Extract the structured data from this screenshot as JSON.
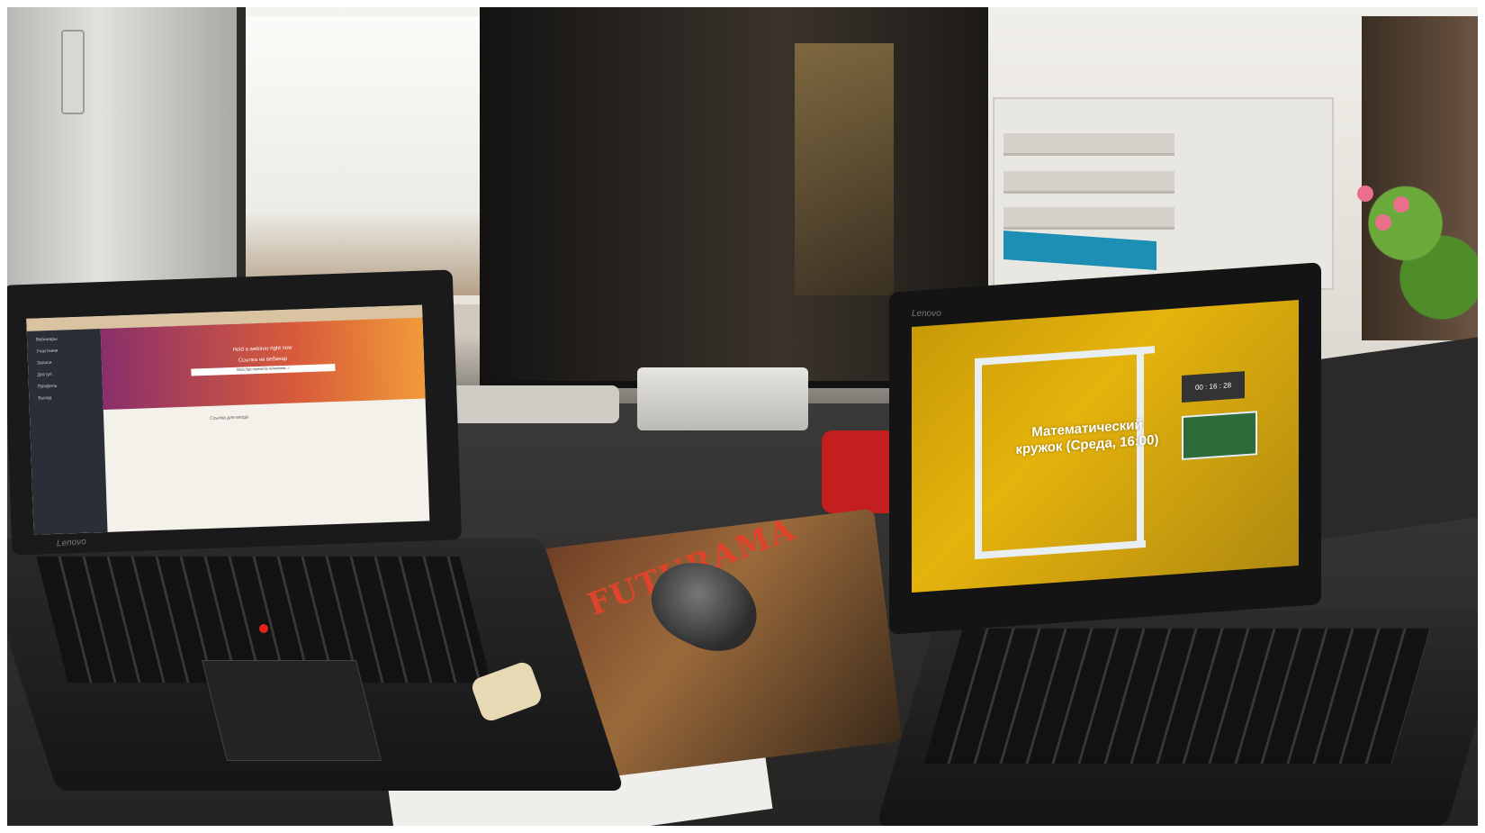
{
  "scene": {
    "description_tags": [
      "desk",
      "two laptops",
      "monitor",
      "mouse pad",
      "mouse",
      "speaker",
      "shelf",
      "window",
      "plant"
    ]
  },
  "left_laptop": {
    "brand": "Lenovo",
    "screen": {
      "sidebar_items": [
        "Вебинары",
        "Участники",
        "Записи",
        "Доступ",
        "Профиль",
        "Выход"
      ],
      "hero_title": "Hold a webinar right now",
      "hero_subtitle": "Ссылка на вебинар",
      "hero_link": "https://go.myevents.ru/webinar.../",
      "section_title": "Ссылка для входа"
    }
  },
  "right_laptop": {
    "brand": "Lenovo",
    "screen": {
      "title": "Математический кружок (Среда, 16:00)",
      "timer": "00 : 16 : 28"
    }
  },
  "mousepad": {
    "title": "FUTURAMA"
  },
  "colors": {
    "speaker": "#c41f1f",
    "trackpoint": "#e2231a",
    "webinar_gradient_start": "#8a2f6b",
    "webinar_gradient_end": "#f09a3a",
    "lesson_screen_bg": "#e5b30c"
  }
}
